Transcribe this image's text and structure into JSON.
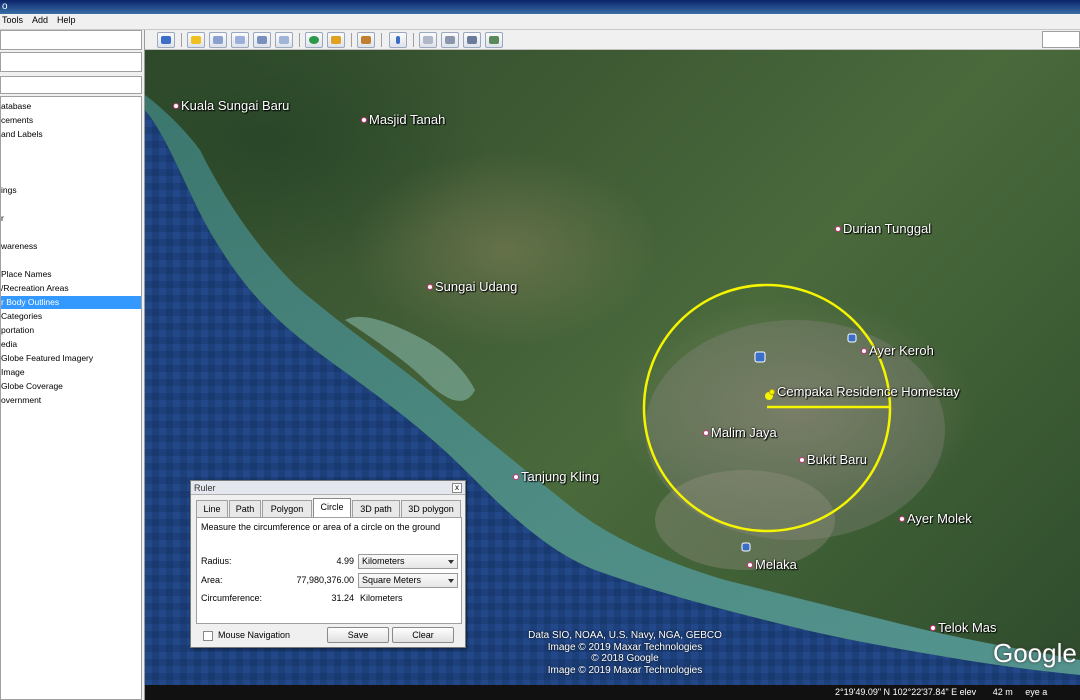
{
  "window": {
    "title": "o"
  },
  "menu": {
    "tools": "Tools",
    "add": "Add",
    "help": "Help"
  },
  "sidebar": {
    "layers": [
      "atabase",
      "cements",
      "and Labels",
      "ings",
      "r",
      "wareness",
      "Place Names",
      "/Recreation Areas",
      "r Body Outlines",
      "Categories",
      "portation",
      "edia",
      "Globe Featured Imagery",
      "Image",
      "Globe Coverage",
      "overnment"
    ],
    "selected_index": 8
  },
  "map": {
    "places": {
      "kuala_sungai_baru": "Kuala Sungai Baru",
      "masjid_tanah": "Masjid Tanah",
      "durian_tunggal": "Durian Tunggal",
      "sungai_udang": "Sungai Udang",
      "ayer_keroh": "Ayer Keroh",
      "cempaka": "Cempaka Residence Homestay",
      "malim_jaya": "Malim Jaya",
      "bukit_baru": "Bukit Baru",
      "tanjung_kling": "Tanjung Kling",
      "ayer_molek": "Ayer Molek",
      "melaka": "Melaka",
      "telok_mas": "Telok Mas"
    },
    "attribution": [
      "Data SIO, NOAA, U.S. Navy, NGA, GEBCO",
      "Image © 2019 Maxar Technologies",
      "© 2018 Google",
      "Image © 2019 Maxar Technologies"
    ],
    "logo": "Google",
    "circle_color": "#f5f500"
  },
  "status": {
    "lat": "2°19'49.09\" N",
    "lon": "102°22'37.84\" E",
    "elev_label": "elev",
    "elev_value": "42 m",
    "eye": "eye a"
  },
  "ruler": {
    "title": "Ruler",
    "close": "x",
    "tabs": [
      "Line",
      "Path",
      "Polygon",
      "Circle",
      "3D path",
      "3D polygon"
    ],
    "active_tab": "Circle",
    "description": "Measure the circumference or area of a circle on the ground",
    "radius_label": "Radius:",
    "radius_value": "4.99",
    "radius_unit": "Kilometers",
    "area_label": "Area:",
    "area_value": "77,980,376.00",
    "area_unit": "Square Meters",
    "circ_label": "Circumference:",
    "circ_value": "31.24",
    "circ_unit": "Kilometers",
    "mouse_nav": "Mouse Navigation",
    "save": "Save",
    "clear": "Clear"
  }
}
